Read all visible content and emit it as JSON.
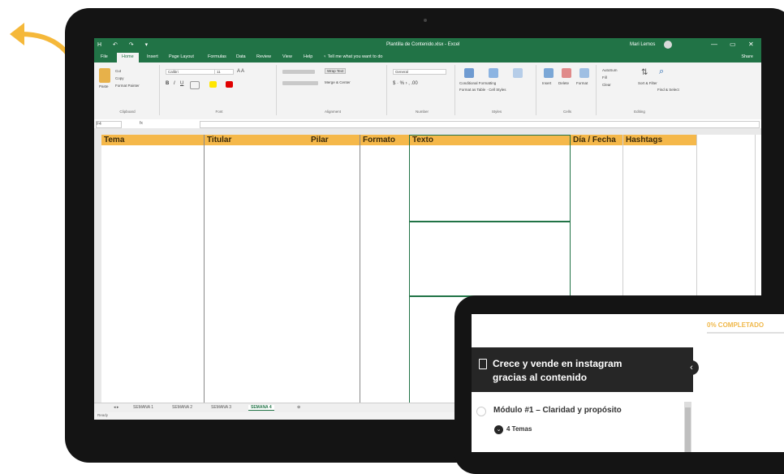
{
  "excel": {
    "quick_access": "H ↶ ↷ ▾",
    "doc_title": "Plantilla de Contenido.xlsx - Excel",
    "user": "Mari Lemos",
    "window_controls": [
      "—",
      "▭",
      "✕"
    ],
    "tabs": [
      "File",
      "Home",
      "Insert",
      "Page Layout",
      "Formulas",
      "Data",
      "Review",
      "View",
      "Help"
    ],
    "tell_me": "Tell me what you want to do",
    "share": "Share",
    "ribbon_groups": [
      "Clipboard",
      "Font",
      "Alignment",
      "Number",
      "Styles",
      "Cells",
      "Editing"
    ],
    "ribbon": {
      "cut": "Cut",
      "copy": "Copy",
      "paste": "Paste",
      "format_painter": "Format Painter",
      "font_name": "Calibri",
      "font_size": "11",
      "wrap_text": "Wrap Text",
      "merge_center": "Merge & Center",
      "number_format": "General",
      "conditional": "Conditional Formatting",
      "format_table": "Format as Table",
      "cell_styles": "Cell Styles",
      "insert": "Insert",
      "delete": "Delete",
      "format": "Format",
      "autosum": "AutoSum",
      "fill": "Fill",
      "clear": "Clear",
      "sort_filter": "Sort & Filter",
      "find_select": "Find & Select"
    },
    "name_box": "F4",
    "fx": "fx",
    "headers": [
      "Tema",
      "Titular",
      "Pilar",
      "Formato",
      "Texto",
      "Día / Fecha",
      "Hashtags"
    ],
    "sheet_tabs": [
      "SEMANA 1",
      "SEMANA 2",
      "SEMANA 3",
      "SEMANA 4"
    ],
    "active_sheet": "SEMANA 4",
    "status": "Ready",
    "accent": "#217346",
    "header_fill": "#f5b84a"
  },
  "course": {
    "progress_label": "0% COMPLETADO",
    "title": "Crece y vende en instagram gracias al contenido",
    "collapse_icon": "‹",
    "module_title": "Módulo #1 – Claridad y propósito",
    "topics": "4 Temas",
    "accent": "#f0b84a"
  }
}
